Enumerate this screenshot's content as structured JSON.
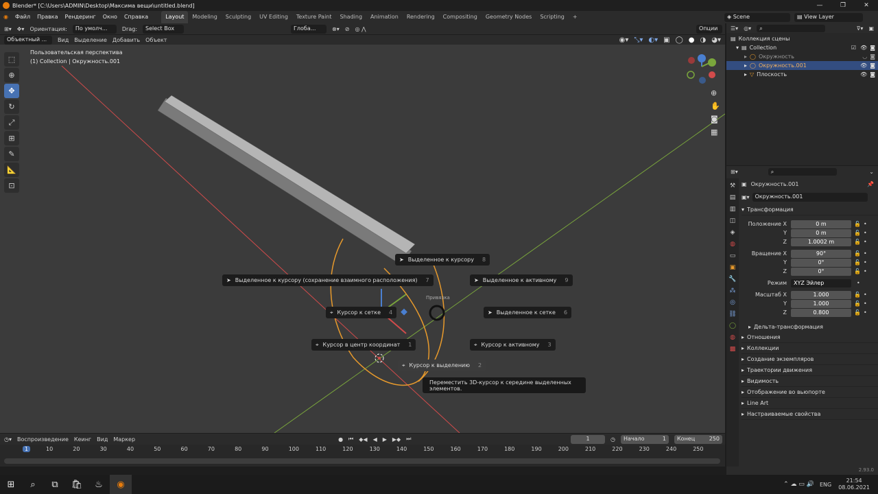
{
  "window": {
    "title": "Blender* [C:\\Users\\ADMIN\\Desktop\\Максима вещи\\untitled.blend]"
  },
  "menu": {
    "items": [
      "Файл",
      "Правка",
      "Рендеринг",
      "Окно",
      "Справка"
    ]
  },
  "workspaces": {
    "tabs": [
      "Layout",
      "Modeling",
      "Sculpting",
      "UV Editing",
      "Texture Paint",
      "Shading",
      "Animation",
      "Rendering",
      "Compositing",
      "Geometry Nodes",
      "Scripting"
    ],
    "active": "Layout",
    "add": "+"
  },
  "scene": {
    "label": "Scene",
    "view_layer": "View Layer"
  },
  "header": {
    "orientation_label": "Ориентация:",
    "orientation_value": "По умолч...",
    "drag_label": "Drag:",
    "drag_value": "Select Box",
    "transform_orient": "Глоба...",
    "options": "Опции"
  },
  "view_header": {
    "mode": "Объектный ...",
    "items": [
      "Вид",
      "Выделение",
      "Добавить",
      "Объект"
    ]
  },
  "viewport": {
    "perspective": "Пользовательская перспектива",
    "collection": "(1) Collection | Окружность.001",
    "snap_label": "Привязка"
  },
  "pie": [
    {
      "label": "Выделенное к курсору",
      "num": "8"
    },
    {
      "label": "Выделенное к курсору (сохранение взаимного расположения)",
      "num": "7"
    },
    {
      "label": "Выделенное к активному",
      "num": "9"
    },
    {
      "label": "Курсор к сетке",
      "num": "4"
    },
    {
      "label": "Выделенное к сетке",
      "num": "6"
    },
    {
      "label": "Курсор в центр координат",
      "num": "1"
    },
    {
      "label": "Курсор к активному",
      "num": "3"
    },
    {
      "label": "Курсор к выделению",
      "num": "2"
    }
  ],
  "tooltip": "Переместить 3D-курсор к середине выделенных элементов.",
  "outliner": {
    "title": "Коллекция сцены",
    "rows": [
      {
        "label": "Collection"
      },
      {
        "label": "Окружность"
      },
      {
        "label": "Окружность.001"
      },
      {
        "label": "Плоскость"
      }
    ]
  },
  "properties": {
    "object_name": "Окружность.001",
    "object_field": "Окружность.001",
    "transform_title": "Трансформация",
    "location": {
      "label": "Положение X",
      "x": "0 m",
      "y": "0 m",
      "z": "1.0002 m"
    },
    "rotation": {
      "label": "Вращение X",
      "x": "90°",
      "y": "0°",
      "z": "0°"
    },
    "mode": {
      "label": "Режим",
      "value": "XYZ Эйлер"
    },
    "scale": {
      "label": "Масштаб X",
      "x": "1.000",
      "y": "1.000",
      "z": "0.800"
    },
    "axis_y": "Y",
    "axis_z": "Z",
    "delta": "Дельта-трансформация",
    "panels": [
      "Отношения",
      "Коллекции",
      "Создание экземпляров",
      "Траектории движения",
      "Видимость",
      "Отображение во вьюпорте",
      "Line Art",
      "Настраиваемые свойства"
    ]
  },
  "timeline": {
    "playback": "Воспроизведение",
    "keying": "Кеинг",
    "view": "Вид",
    "marker": "Маркер",
    "current_frame": "1",
    "start_label": "Начало",
    "start": "1",
    "end_label": "Конец",
    "end": "250",
    "ticks": [
      "1",
      "10",
      "20",
      "30",
      "40",
      "50",
      "60",
      "70",
      "80",
      "90",
      "100",
      "110",
      "120",
      "130",
      "140",
      "150",
      "160",
      "170",
      "180",
      "190",
      "200",
      "210",
      "220",
      "230",
      "240",
      "250"
    ]
  },
  "status": {
    "version": "2.93.0"
  },
  "taskbar": {
    "lang": "ENG",
    "time": "21:54",
    "date": "08.06.2021"
  },
  "colors": {
    "accent": "#4772b3",
    "selection": "#334d80",
    "x_axis": "#d24b4b",
    "y_axis": "#7aa63c",
    "highlight_orange": "#e89a2c"
  }
}
